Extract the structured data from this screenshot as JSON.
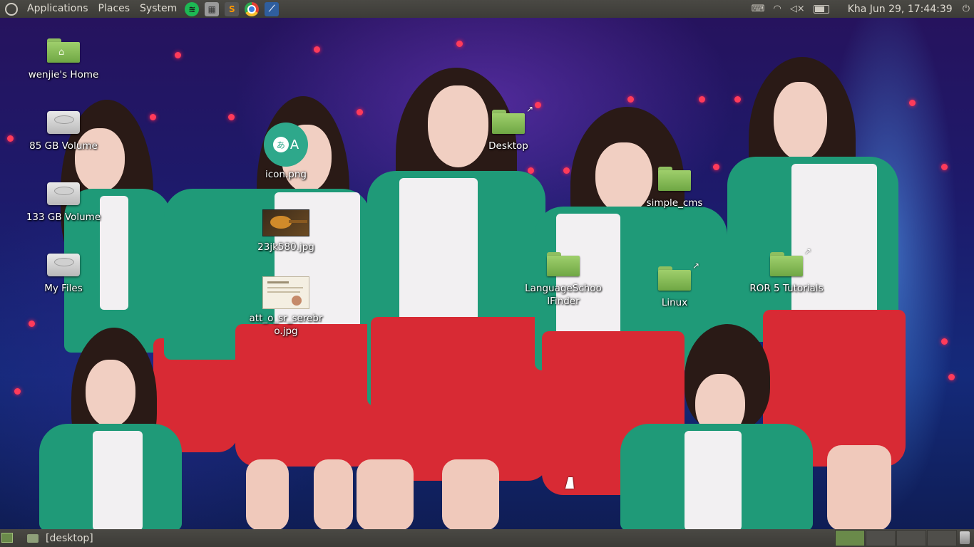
{
  "top_panel": {
    "menus": [
      "Applications",
      "Places",
      "System"
    ],
    "launchers": [
      {
        "icon": "spotify-icon",
        "color": "#1db954",
        "glyph": "≋"
      },
      {
        "icon": "calculator-icon",
        "color": "#9a9a9a",
        "glyph": "▦"
      },
      {
        "icon": "sublime-text-icon",
        "color": "#4a4a4a",
        "glyph": "S"
      },
      {
        "icon": "chrome-icon",
        "color": "#e34133",
        "glyph": "◉"
      },
      {
        "icon": "network-tool-icon",
        "color": "#2f5e9e",
        "glyph": "⟋"
      }
    ],
    "clock": "Kha Jun 29, 17:44:39"
  },
  "desktop": {
    "icons": [
      {
        "name": "home-folder",
        "label": "wenjie's Home",
        "type": "home"
      },
      {
        "name": "volume-85gb",
        "label": "85 GB Volume",
        "type": "drive"
      },
      {
        "name": "volume-133gb",
        "label": "133 GB Volume",
        "type": "drive"
      },
      {
        "name": "my-files",
        "label": "My Files",
        "type": "drive"
      },
      {
        "name": "icon-png",
        "label": "icon.png",
        "type": "image"
      },
      {
        "name": "image-23jk580",
        "label": "23jk580.jpg",
        "type": "image"
      },
      {
        "name": "image-att-o-sr-serebro",
        "label": "att_o_sr_serebro.jpg",
        "type": "image"
      },
      {
        "name": "desktop-link",
        "label": "Desktop",
        "type": "folder-link"
      },
      {
        "name": "simple-cms-folder",
        "label": "simple_cms",
        "type": "folder"
      },
      {
        "name": "language-school-finder-folder",
        "label": "LanguageSchoolFinder",
        "type": "folder"
      },
      {
        "name": "linux-link",
        "label": "Linux",
        "type": "folder-link"
      },
      {
        "name": "ror5-tutorials-link",
        "label": "ROR 5 Tutorials",
        "type": "folder-link"
      }
    ]
  },
  "bottom_panel": {
    "task_label": "[desktop]",
    "workspaces": [
      "1",
      "2",
      "3",
      "4"
    ],
    "active_workspace": 1
  },
  "colors": {
    "panel": "#3c3b37",
    "folder_green": "#87bb5a",
    "accent_teal": "#2ea88b"
  }
}
